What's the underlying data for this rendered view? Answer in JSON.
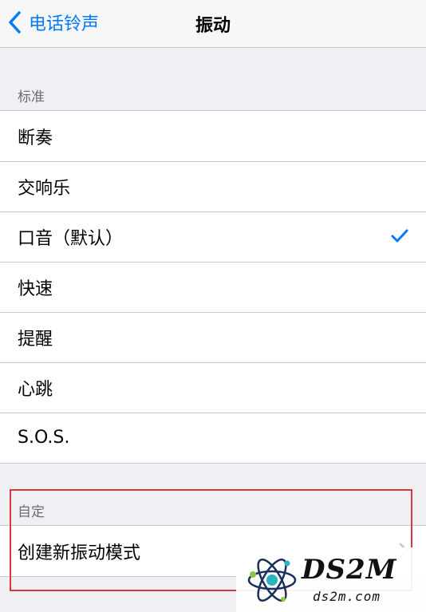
{
  "nav": {
    "back_label": "电话铃声",
    "title": "振动"
  },
  "standard": {
    "header": "标准",
    "items": [
      {
        "label": "断奏",
        "selected": false
      },
      {
        "label": "交响乐",
        "selected": false
      },
      {
        "label": "口音（默认）",
        "selected": true
      },
      {
        "label": "快速",
        "selected": false
      },
      {
        "label": "提醒",
        "selected": false
      },
      {
        "label": "心跳",
        "selected": false
      },
      {
        "label": "S.O.S.",
        "selected": false
      }
    ]
  },
  "custom": {
    "header": "自定",
    "create_label": "创建新振动模式"
  },
  "watermark": {
    "title": "DS2M",
    "subtitle": "ds2m.com"
  },
  "colors": {
    "accent": "#007aff",
    "highlight": "#d9383a",
    "background": "#efeff4"
  },
  "icons": {
    "back": "chevron-left-icon",
    "selected": "checkmark-icon",
    "disclosure": "chevron-right-icon",
    "logo": "atom-logo-icon"
  }
}
